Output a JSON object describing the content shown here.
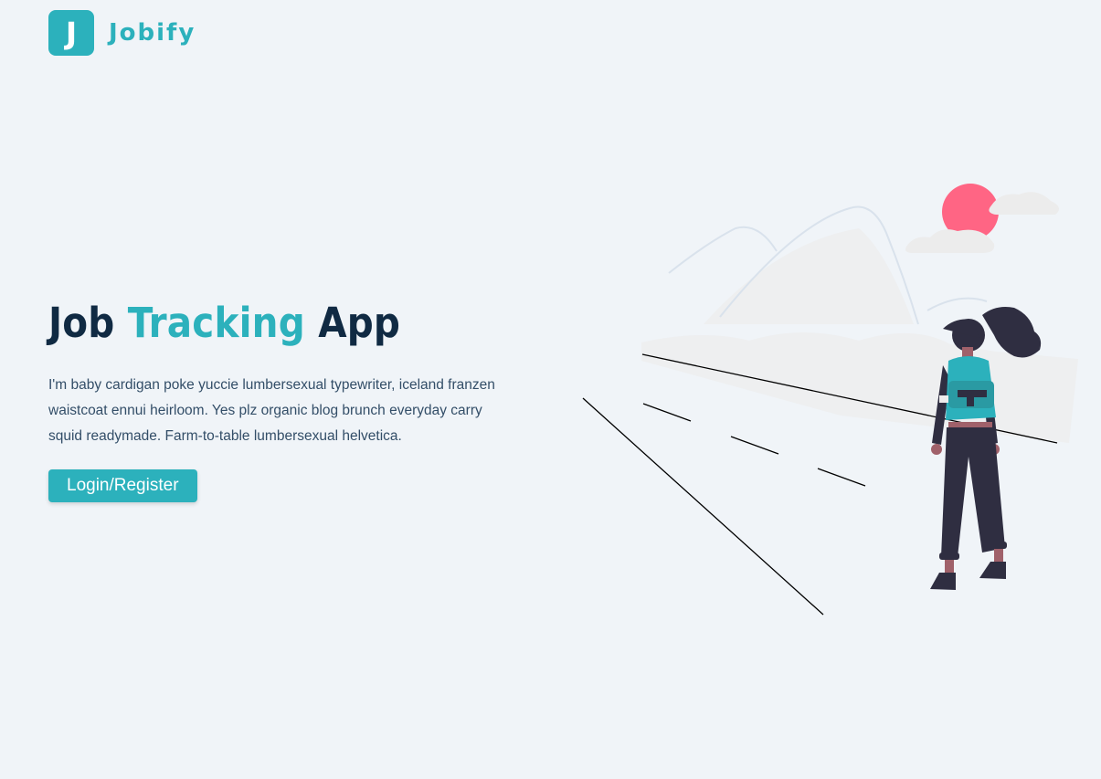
{
  "brand": {
    "logo_letter": "J",
    "name": "Jobify",
    "accent_color": "#2cb1bc"
  },
  "hero": {
    "title_part1": "Job",
    "title_accent": "Tracking",
    "title_part2": "App",
    "description": "I'm baby cardigan poke yuccie lumbersexual typewriter, iceland franzen waistcoat ennui heirloom. Yes plz organic blog brunch everyday carry squid readymade. Farm-to-table lumbersexual helvetica.",
    "button_label": "Login/Register"
  },
  "colors": {
    "background": "#f0f4f8",
    "heading": "#102a43",
    "body_text": "#334e68",
    "sun": "#ff6584",
    "figure_dark": "#2f2e41",
    "backpack": "#2cb1bc"
  },
  "illustration": {
    "icon": "woman-with-backpack-road-illustration"
  }
}
